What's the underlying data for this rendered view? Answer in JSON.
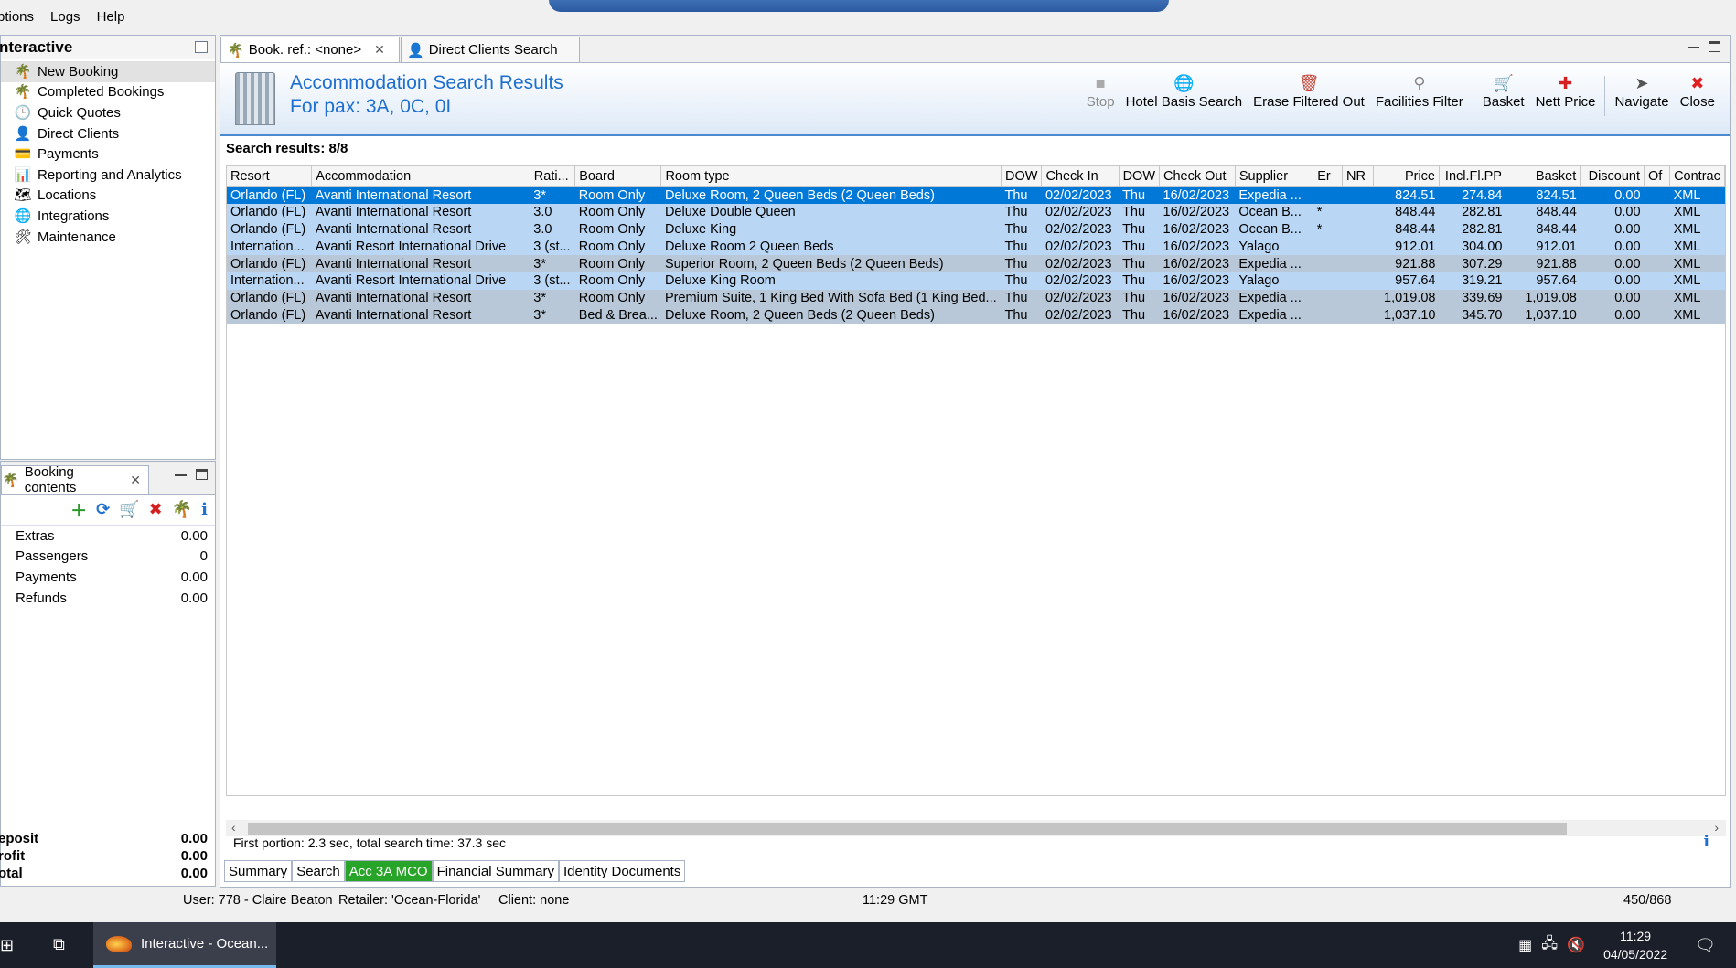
{
  "menu": [
    "ptions",
    "Logs",
    "Help"
  ],
  "nav": {
    "title": "nteractive",
    "items": [
      {
        "label": "New Booking",
        "icon": "palm-icon",
        "glyph": "🌴",
        "selected": true
      },
      {
        "label": "Completed Bookings",
        "icon": "palm-check-icon",
        "glyph": "🌴",
        "selected": false
      },
      {
        "label": "Quick Quotes",
        "icon": "clock-icon",
        "glyph": "🕒",
        "selected": false
      },
      {
        "label": "Direct Clients",
        "icon": "client-icon",
        "glyph": "👤",
        "selected": false
      },
      {
        "label": "Payments",
        "icon": "payment-icon",
        "glyph": "💳",
        "selected": false
      },
      {
        "label": "Reporting and Analytics",
        "icon": "report-icon",
        "glyph": "📊",
        "selected": false
      },
      {
        "label": "Locations",
        "icon": "map-icon",
        "glyph": "🗺",
        "selected": false
      },
      {
        "label": "Integrations",
        "icon": "globe-icon",
        "glyph": "🌐",
        "selected": false
      },
      {
        "label": "Maintenance",
        "icon": "maintenance-icon",
        "glyph": "🛠",
        "selected": false
      }
    ]
  },
  "booking_contents": {
    "tab_label": "Booking contents",
    "rows": [
      {
        "label": "Extras",
        "value": "0.00"
      },
      {
        "label": "Passengers",
        "value": "0"
      },
      {
        "label": "Payments",
        "value": "0.00"
      },
      {
        "label": "Refunds",
        "value": "0.00"
      }
    ],
    "totals": [
      {
        "label": "Deposit",
        "value": "0.00"
      },
      {
        "label": "Profit",
        "value": "0.00"
      },
      {
        "label": "Total",
        "value": "0.00"
      }
    ],
    "totals_display": [
      "eposit",
      "rofit",
      "otal"
    ]
  },
  "tabs": [
    {
      "label": "Book. ref.: <none>",
      "active": true,
      "closable": true
    },
    {
      "label": "Direct Clients Search",
      "active": false,
      "closable": false
    }
  ],
  "results": {
    "title": "Accommodation Search Results",
    "subtitle": "For pax: 3A, 0C, 0I",
    "count": "Search results: 8/8",
    "toolbar": [
      {
        "label": "Stop",
        "icon": "stop-icon",
        "glyph": "■",
        "disabled": true
      },
      {
        "label": "Hotel Basis Search",
        "icon": "globe-search-icon",
        "glyph": "🌐",
        "disabled": false
      },
      {
        "label": "Erase Filtered Out",
        "icon": "erase-icon",
        "glyph": "🗑",
        "disabled": false
      },
      {
        "label": "Facilities Filter",
        "icon": "filter-icon",
        "glyph": "⚲",
        "disabled": false
      },
      {
        "label": "Basket",
        "icon": "basket-icon",
        "glyph": "🛒",
        "disabled": false
      },
      {
        "label": "Nett Price",
        "icon": "nett-price-icon",
        "glyph": "✚",
        "disabled": false
      },
      {
        "label": "Navigate",
        "icon": "navigate-icon",
        "glyph": "➤",
        "disabled": false
      },
      {
        "label": "Close",
        "icon": "close-icon",
        "glyph": "✖",
        "disabled": false
      }
    ],
    "columns": [
      "Resort",
      "Accommodation",
      "Rati...",
      "Board",
      "Room type",
      "DOW",
      "Check In",
      "DOW",
      "Check Out",
      "Supplier",
      "Er",
      "NR",
      "Price",
      "Incl.Fl.PP",
      "Basket",
      "Discount",
      "Of",
      "Contrac"
    ],
    "rows": [
      {
        "style": "sel",
        "cells": [
          "Orlando (FL)",
          "Avanti International Resort",
          "3*",
          "Room Only",
          "Deluxe Room, 2 Queen Beds (2 Queen Beds)",
          "Thu",
          "02/02/2023",
          "Thu",
          "16/02/2023",
          "Expedia ...",
          "",
          "",
          "824.51",
          "274.84",
          "824.51",
          "0.00",
          "",
          "XML"
        ]
      },
      {
        "style": "light",
        "cells": [
          "Orlando (FL)",
          "Avanti International Resort",
          "3.0",
          "Room Only",
          "Deluxe Double Queen",
          "Thu",
          "02/02/2023",
          "Thu",
          "16/02/2023",
          "Ocean B...",
          "*",
          "",
          "848.44",
          "282.81",
          "848.44",
          "0.00",
          "",
          "XML"
        ]
      },
      {
        "style": "light",
        "cells": [
          "Orlando (FL)",
          "Avanti International Resort",
          "3.0",
          "Room Only",
          "Deluxe King",
          "Thu",
          "02/02/2023",
          "Thu",
          "16/02/2023",
          "Ocean B...",
          "*",
          "",
          "848.44",
          "282.81",
          "848.44",
          "0.00",
          "",
          "XML"
        ]
      },
      {
        "style": "light",
        "cells": [
          "Internation...",
          "Avanti Resort International Drive",
          "3 (st...",
          "Room Only",
          "Deluxe Room 2 Queen Beds",
          "Thu",
          "02/02/2023",
          "Thu",
          "16/02/2023",
          "Yalago",
          "",
          "",
          "912.01",
          "304.00",
          "912.01",
          "0.00",
          "",
          "XML"
        ]
      },
      {
        "style": "gray",
        "cells": [
          "Orlando (FL)",
          "Avanti International Resort",
          "3*",
          "Room Only",
          "Superior Room, 2 Queen Beds (2 Queen Beds)",
          "Thu",
          "02/02/2023",
          "Thu",
          "16/02/2023",
          "Expedia ...",
          "",
          "",
          "921.88",
          "307.29",
          "921.88",
          "0.00",
          "",
          "XML"
        ]
      },
      {
        "style": "light",
        "cells": [
          "Internation...",
          "Avanti Resort International Drive",
          "3 (st...",
          "Room Only",
          "Deluxe King Room",
          "Thu",
          "02/02/2023",
          "Thu",
          "16/02/2023",
          "Yalago",
          "",
          "",
          "957.64",
          "319.21",
          "957.64",
          "0.00",
          "",
          "XML"
        ]
      },
      {
        "style": "gray",
        "cells": [
          "Orlando (FL)",
          "Avanti International Resort",
          "3*",
          "Room Only",
          "Premium Suite, 1 King Bed With Sofa Bed (1 King Bed...",
          "Thu",
          "02/02/2023",
          "Thu",
          "16/02/2023",
          "Expedia ...",
          "",
          "",
          "1,019.08",
          "339.69",
          "1,019.08",
          "0.00",
          "",
          "XML"
        ]
      },
      {
        "style": "gray",
        "cells": [
          "Orlando (FL)",
          "Avanti International Resort",
          "3*",
          "Bed & Brea...",
          "Deluxe Room, 2 Queen Beds (2 Queen Beds)",
          "Thu",
          "02/02/2023",
          "Thu",
          "16/02/2023",
          "Expedia ...",
          "",
          "",
          "1,037.10",
          "345.70",
          "1,037.10",
          "0.00",
          "",
          "XML"
        ]
      }
    ],
    "timing": "First portion: 2.3 sec, total search time: 37.3 sec"
  },
  "bottom_tabs": [
    {
      "label": "Summary",
      "active": false
    },
    {
      "label": "Search",
      "active": false
    },
    {
      "label": "Acc 3A MCO",
      "active": true
    },
    {
      "label": "Financial Summary",
      "active": false
    },
    {
      "label": "Identity Documents",
      "active": false
    }
  ],
  "statusbar": {
    "user": "User: 778 - Claire Beaton",
    "retailer": "Retailer: 'Ocean-Florida'",
    "client": "Client: none",
    "time": "11:29 GMT",
    "memory": "450/868"
  },
  "taskbar": {
    "app_label": "Interactive - Ocean...",
    "time": "11:29",
    "date": "04/05/2022"
  },
  "colors": {
    "selection": "#0078d7",
    "accent_title": "#1e6fd0",
    "active_tab_green": "#28a428"
  }
}
